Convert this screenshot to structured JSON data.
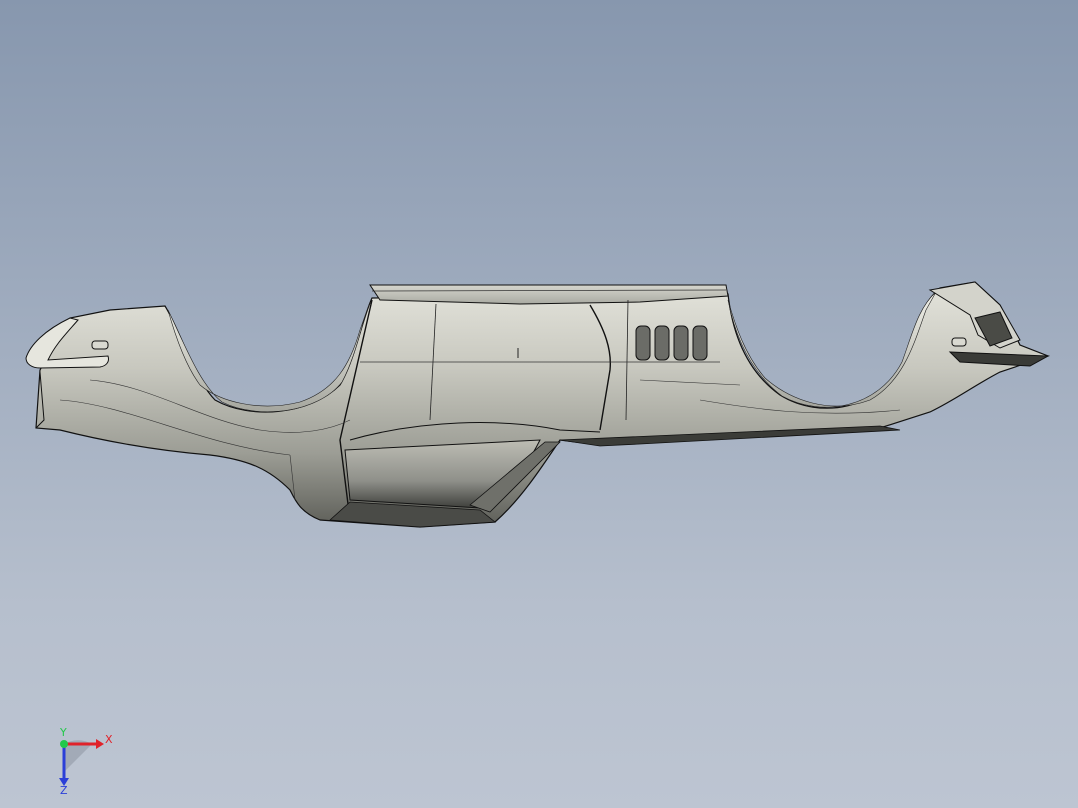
{
  "viewport": {
    "background_top": "#8797ae",
    "background_bottom": "#bdc5d2"
  },
  "model": {
    "body_color": "#c9c9c0",
    "edge_color": "#111111",
    "shadow_color": "#2f302d"
  },
  "triad": {
    "x_label": "X",
    "y_label": "Y",
    "z_label": "Z",
    "x_color": "#e0222a",
    "y_color": "#22c84a",
    "z_color": "#2b3fd8"
  }
}
